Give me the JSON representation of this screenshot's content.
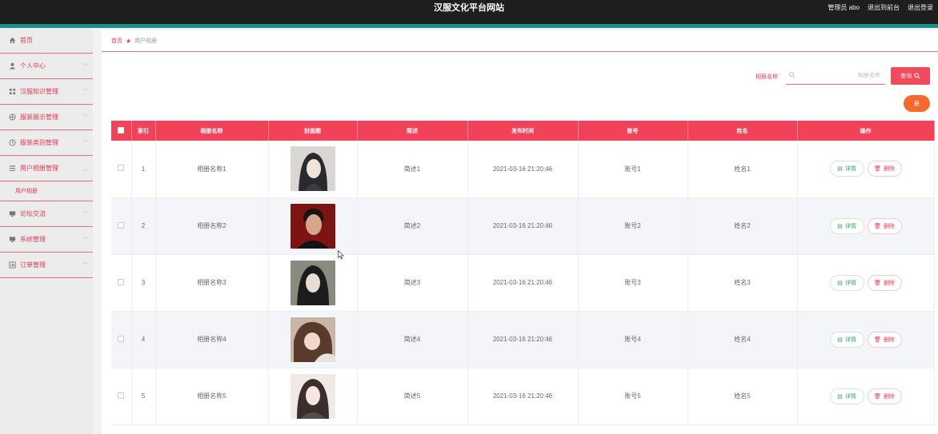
{
  "header": {
    "site_title": "汉服文化平台网站",
    "admin_label": "管理员 abo",
    "front_link": "退出到前台",
    "logout_link": "退出登录"
  },
  "sidebar": {
    "items": [
      {
        "label": "首页",
        "icon": "home-icon"
      },
      {
        "label": "个人中心",
        "icon": "user-icon"
      },
      {
        "label": "汉服知识管理",
        "icon": "grid-icon"
      },
      {
        "label": "服装展示管理",
        "icon": "globe-icon"
      },
      {
        "label": "服装类别管理",
        "icon": "clock-icon"
      },
      {
        "label": "用户相册管理",
        "icon": "menu-icon"
      },
      {
        "label": "论坛交流",
        "icon": "monitor-icon"
      },
      {
        "label": "系统管理",
        "icon": "monitor-icon"
      },
      {
        "label": "订单管理",
        "icon": "chart-icon"
      }
    ],
    "sub_item": "用户相册"
  },
  "breadcrumb": {
    "home": "首页",
    "current": "用户相册"
  },
  "search": {
    "label": "相册名称",
    "placeholder": "相册名称",
    "button": "查询"
  },
  "delete_button": "册",
  "table": {
    "headers": [
      "索引",
      "相册名称",
      "封面图",
      "简述",
      "发布时间",
      "账号",
      "姓名",
      "操作"
    ],
    "detail_label": "详情",
    "delete_label": "删除",
    "rows": [
      {
        "index": "1",
        "name": "相册名称1",
        "desc": "简述1",
        "time": "2021-03-16 21:20:46",
        "account": "账号1",
        "person": "姓名1"
      },
      {
        "index": "2",
        "name": "相册名称2",
        "desc": "简述2",
        "time": "2021-03-16 21:20:46",
        "account": "账号2",
        "person": "姓名2"
      },
      {
        "index": "3",
        "name": "相册名称3",
        "desc": "简述3",
        "time": "2021-03-16 21:20:46",
        "account": "账号3",
        "person": "姓名3"
      },
      {
        "index": "4",
        "name": "相册名称4",
        "desc": "简述4",
        "time": "2021-03-16 21:20:46",
        "account": "账号4",
        "person": "姓名4"
      },
      {
        "index": "5",
        "name": "相册名称5",
        "desc": "简述5",
        "time": "2021-03-16 21:20:46",
        "account": "账号5",
        "person": "姓名5"
      }
    ]
  },
  "colors": {
    "accent": "#f2425a",
    "topbar": "#1e1e1e",
    "teal_stripe": "#1a8f86",
    "orange": "#f26a2e"
  }
}
